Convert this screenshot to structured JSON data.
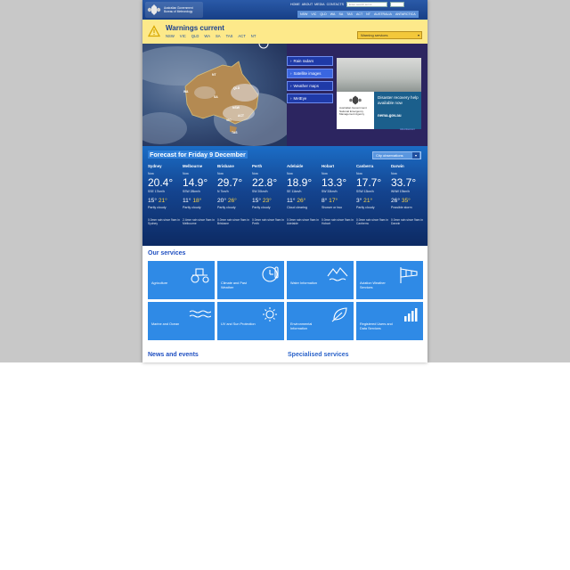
{
  "header": {
    "logo_line1": "Australian Government",
    "logo_line2": "Bureau of Meteorology",
    "top_links": [
      "HOME",
      "ABOUT",
      "MEDIA",
      "CONTACTS"
    ],
    "search_placeholder": "Enter search terms",
    "state_links": [
      "NSW",
      "VIC",
      "QLD",
      "WA",
      "SA",
      "TAS",
      "ACT",
      "NT",
      "AUSTRALIA",
      "ANTARCTICA"
    ]
  },
  "warnings": {
    "title": "Warnings current",
    "states": [
      "NSW",
      "VIC",
      "QLD",
      "WA",
      "SA",
      "TAS",
      "ACT",
      "NT"
    ],
    "select_value": "Warning services"
  },
  "hero": {
    "map_labels": [
      "NT",
      "QLD",
      "WA",
      "SA",
      "NSW",
      "VIC",
      "ACT",
      "TAS"
    ],
    "links": [
      "Rain radars",
      "Satellite images",
      "Weather maps",
      "MetEye"
    ],
    "promo": {
      "org_line1": "Australian Government",
      "org_line2": "National Emergency Management Agency",
      "text": "Disaster recovery help available now",
      "url": "nema.gov.au",
      "attrib": "Advertisement"
    }
  },
  "forecast": {
    "title": "Forecast for Friday 9 December",
    "obs_select": "City observations",
    "cities": [
      {
        "name": "Sydney",
        "now": "Now",
        "temp": "20.4°",
        "wind": "SSE 17km/h",
        "min": "15°",
        "max": "21°",
        "cond": "Partly cloudy",
        "rain": "0.0mm rain since 9am in Sydney"
      },
      {
        "name": "Melbourne",
        "now": "Now",
        "temp": "14.9°",
        "wind": "SSW 28km/h",
        "min": "11°",
        "max": "18°",
        "cond": "Partly cloudy",
        "rain": "2.4mm rain since 9am in Melbourne"
      },
      {
        "name": "Brisbane",
        "now": "Now",
        "temp": "29.7°",
        "wind": "N 7km/h",
        "min": "20°",
        "max": "26°",
        "cond": "Partly cloudy",
        "rain": "0.0mm rain since 9am in Brisbane"
      },
      {
        "name": "Perth",
        "now": "Now",
        "temp": "22.8°",
        "wind": "SW 20km/h",
        "min": "15°",
        "max": "23°",
        "cond": "Partly cloudy",
        "rain": "0.0mm rain since 9am in Perth"
      },
      {
        "name": "Adelaide",
        "now": "Now",
        "temp": "18.9°",
        "wind": "SE 11km/h",
        "min": "11°",
        "max": "26°",
        "cond": "Cloud clearing",
        "rain": "0.0mm rain since 9am in Adelaide"
      },
      {
        "name": "Hobart",
        "now": "Now",
        "temp": "13.3°",
        "wind": "SW 33km/h",
        "min": "8°",
        "max": "17°",
        "cond": "Shower or two",
        "rain": "0.0mm rain since 9am in Hobart"
      },
      {
        "name": "Canberra",
        "now": "Now",
        "temp": "17.7°",
        "wind": "SSW 13km/h",
        "min": "3°",
        "max": "21°",
        "cond": "Partly cloudy",
        "rain": "0.0mm rain since 9am in Canberra"
      },
      {
        "name": "Darwin",
        "now": "Now",
        "temp": "33.7°",
        "wind": "WNW 19km/h",
        "min": "26°",
        "max": "35°",
        "cond": "Possible storm",
        "rain": "0.0mm rain since 9am in Darwin"
      }
    ]
  },
  "services": {
    "title": "Our services",
    "items": [
      {
        "label": "Agriculture",
        "icon": "tractor-icon"
      },
      {
        "label": "Climate and Past Weather",
        "icon": "thermometer-clock-icon"
      },
      {
        "label": "Water Information",
        "icon": "mountain-water-icon"
      },
      {
        "label": "Aviation Weather Services",
        "icon": "windsock-icon"
      },
      {
        "label": "Marine and Ocean",
        "icon": "waves-icon"
      },
      {
        "label": "UV and Sun Protection",
        "icon": "sun-icon"
      },
      {
        "label": "Environmental Information",
        "icon": "leaf-icon"
      },
      {
        "label": "Registered Users and Data Services",
        "icon": "bar-chart-icon"
      }
    ]
  },
  "news_title": "News and events",
  "specialised_title": "Specialised services"
}
